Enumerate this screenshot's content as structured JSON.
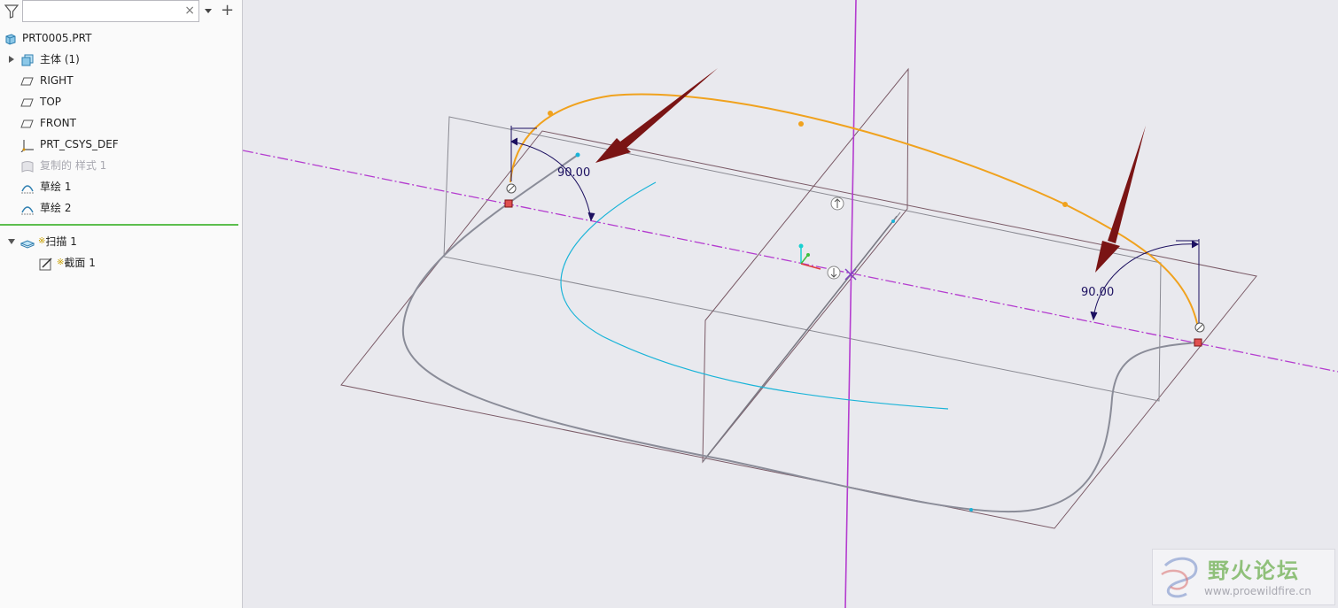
{
  "search": {
    "value": "",
    "placeholder": ""
  },
  "tree": {
    "items": [
      {
        "label": "PRT0005.PRT",
        "icon": "part-icon"
      },
      {
        "label": "主体 (1)",
        "icon": "body-icon"
      },
      {
        "label": "RIGHT",
        "icon": "datum-plane-icon"
      },
      {
        "label": "TOP",
        "icon": "datum-plane-icon"
      },
      {
        "label": "FRONT",
        "icon": "datum-plane-icon"
      },
      {
        "label": "PRT_CSYS_DEF",
        "icon": "csys-icon"
      },
      {
        "label": "复制的 样式 1",
        "icon": "style-icon"
      },
      {
        "label": "草绘 1",
        "icon": "sketch-icon"
      },
      {
        "label": "草绘 2",
        "icon": "sketch-icon"
      },
      {
        "label": "扫描 1",
        "icon": "sweep-icon",
        "marker": "※"
      },
      {
        "label": "截面 1",
        "icon": "section-sketch-icon",
        "marker": "※"
      }
    ]
  },
  "viewport": {
    "dimension_left": "90.00",
    "dimension_right": "90.00"
  },
  "watermark": {
    "title": "野火论坛",
    "url": "www.proewildfire.cn"
  },
  "colors": {
    "trajectory": "#f0a21e",
    "spine_curve": "#1ab4d8",
    "guide_curve": "#8a8c98",
    "datum_axis": "#b43ccf",
    "arrow": "#7a1414",
    "dimension": "#1c1060",
    "selection_line": "#5cbe4e"
  }
}
